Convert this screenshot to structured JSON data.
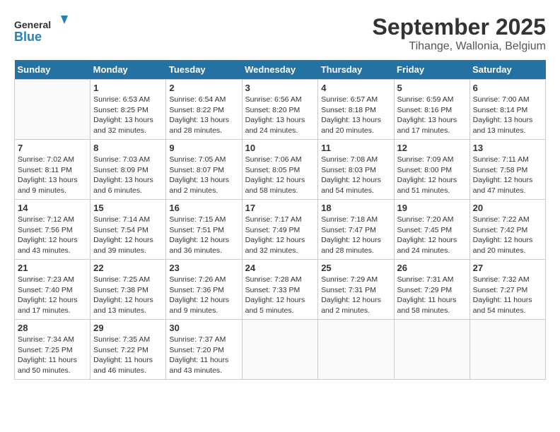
{
  "header": {
    "logo_general": "General",
    "logo_blue": "Blue",
    "month_title": "September 2025",
    "location": "Tihange, Wallonia, Belgium"
  },
  "days_of_week": [
    "Sunday",
    "Monday",
    "Tuesday",
    "Wednesday",
    "Thursday",
    "Friday",
    "Saturday"
  ],
  "weeks": [
    [
      {
        "day": "",
        "sunrise": "",
        "sunset": "",
        "daylight": ""
      },
      {
        "day": "1",
        "sunrise": "Sunrise: 6:53 AM",
        "sunset": "Sunset: 8:25 PM",
        "daylight": "Daylight: 13 hours and 32 minutes."
      },
      {
        "day": "2",
        "sunrise": "Sunrise: 6:54 AM",
        "sunset": "Sunset: 8:22 PM",
        "daylight": "Daylight: 13 hours and 28 minutes."
      },
      {
        "day": "3",
        "sunrise": "Sunrise: 6:56 AM",
        "sunset": "Sunset: 8:20 PM",
        "daylight": "Daylight: 13 hours and 24 minutes."
      },
      {
        "day": "4",
        "sunrise": "Sunrise: 6:57 AM",
        "sunset": "Sunset: 8:18 PM",
        "daylight": "Daylight: 13 hours and 20 minutes."
      },
      {
        "day": "5",
        "sunrise": "Sunrise: 6:59 AM",
        "sunset": "Sunset: 8:16 PM",
        "daylight": "Daylight: 13 hours and 17 minutes."
      },
      {
        "day": "6",
        "sunrise": "Sunrise: 7:00 AM",
        "sunset": "Sunset: 8:14 PM",
        "daylight": "Daylight: 13 hours and 13 minutes."
      }
    ],
    [
      {
        "day": "7",
        "sunrise": "Sunrise: 7:02 AM",
        "sunset": "Sunset: 8:11 PM",
        "daylight": "Daylight: 13 hours and 9 minutes."
      },
      {
        "day": "8",
        "sunrise": "Sunrise: 7:03 AM",
        "sunset": "Sunset: 8:09 PM",
        "daylight": "Daylight: 13 hours and 6 minutes."
      },
      {
        "day": "9",
        "sunrise": "Sunrise: 7:05 AM",
        "sunset": "Sunset: 8:07 PM",
        "daylight": "Daylight: 13 hours and 2 minutes."
      },
      {
        "day": "10",
        "sunrise": "Sunrise: 7:06 AM",
        "sunset": "Sunset: 8:05 PM",
        "daylight": "Daylight: 12 hours and 58 minutes."
      },
      {
        "day": "11",
        "sunrise": "Sunrise: 7:08 AM",
        "sunset": "Sunset: 8:03 PM",
        "daylight": "Daylight: 12 hours and 54 minutes."
      },
      {
        "day": "12",
        "sunrise": "Sunrise: 7:09 AM",
        "sunset": "Sunset: 8:00 PM",
        "daylight": "Daylight: 12 hours and 51 minutes."
      },
      {
        "day": "13",
        "sunrise": "Sunrise: 7:11 AM",
        "sunset": "Sunset: 7:58 PM",
        "daylight": "Daylight: 12 hours and 47 minutes."
      }
    ],
    [
      {
        "day": "14",
        "sunrise": "Sunrise: 7:12 AM",
        "sunset": "Sunset: 7:56 PM",
        "daylight": "Daylight: 12 hours and 43 minutes."
      },
      {
        "day": "15",
        "sunrise": "Sunrise: 7:14 AM",
        "sunset": "Sunset: 7:54 PM",
        "daylight": "Daylight: 12 hours and 39 minutes."
      },
      {
        "day": "16",
        "sunrise": "Sunrise: 7:15 AM",
        "sunset": "Sunset: 7:51 PM",
        "daylight": "Daylight: 12 hours and 36 minutes."
      },
      {
        "day": "17",
        "sunrise": "Sunrise: 7:17 AM",
        "sunset": "Sunset: 7:49 PM",
        "daylight": "Daylight: 12 hours and 32 minutes."
      },
      {
        "day": "18",
        "sunrise": "Sunrise: 7:18 AM",
        "sunset": "Sunset: 7:47 PM",
        "daylight": "Daylight: 12 hours and 28 minutes."
      },
      {
        "day": "19",
        "sunrise": "Sunrise: 7:20 AM",
        "sunset": "Sunset: 7:45 PM",
        "daylight": "Daylight: 12 hours and 24 minutes."
      },
      {
        "day": "20",
        "sunrise": "Sunrise: 7:22 AM",
        "sunset": "Sunset: 7:42 PM",
        "daylight": "Daylight: 12 hours and 20 minutes."
      }
    ],
    [
      {
        "day": "21",
        "sunrise": "Sunrise: 7:23 AM",
        "sunset": "Sunset: 7:40 PM",
        "daylight": "Daylight: 12 hours and 17 minutes."
      },
      {
        "day": "22",
        "sunrise": "Sunrise: 7:25 AM",
        "sunset": "Sunset: 7:38 PM",
        "daylight": "Daylight: 12 hours and 13 minutes."
      },
      {
        "day": "23",
        "sunrise": "Sunrise: 7:26 AM",
        "sunset": "Sunset: 7:36 PM",
        "daylight": "Daylight: 12 hours and 9 minutes."
      },
      {
        "day": "24",
        "sunrise": "Sunrise: 7:28 AM",
        "sunset": "Sunset: 7:33 PM",
        "daylight": "Daylight: 12 hours and 5 minutes."
      },
      {
        "day": "25",
        "sunrise": "Sunrise: 7:29 AM",
        "sunset": "Sunset: 7:31 PM",
        "daylight": "Daylight: 12 hours and 2 minutes."
      },
      {
        "day": "26",
        "sunrise": "Sunrise: 7:31 AM",
        "sunset": "Sunset: 7:29 PM",
        "daylight": "Daylight: 11 hours and 58 minutes."
      },
      {
        "day": "27",
        "sunrise": "Sunrise: 7:32 AM",
        "sunset": "Sunset: 7:27 PM",
        "daylight": "Daylight: 11 hours and 54 minutes."
      }
    ],
    [
      {
        "day": "28",
        "sunrise": "Sunrise: 7:34 AM",
        "sunset": "Sunset: 7:25 PM",
        "daylight": "Daylight: 11 hours and 50 minutes."
      },
      {
        "day": "29",
        "sunrise": "Sunrise: 7:35 AM",
        "sunset": "Sunset: 7:22 PM",
        "daylight": "Daylight: 11 hours and 46 minutes."
      },
      {
        "day": "30",
        "sunrise": "Sunrise: 7:37 AM",
        "sunset": "Sunset: 7:20 PM",
        "daylight": "Daylight: 11 hours and 43 minutes."
      },
      {
        "day": "",
        "sunrise": "",
        "sunset": "",
        "daylight": ""
      },
      {
        "day": "",
        "sunrise": "",
        "sunset": "",
        "daylight": ""
      },
      {
        "day": "",
        "sunrise": "",
        "sunset": "",
        "daylight": ""
      },
      {
        "day": "",
        "sunrise": "",
        "sunset": "",
        "daylight": ""
      }
    ]
  ]
}
